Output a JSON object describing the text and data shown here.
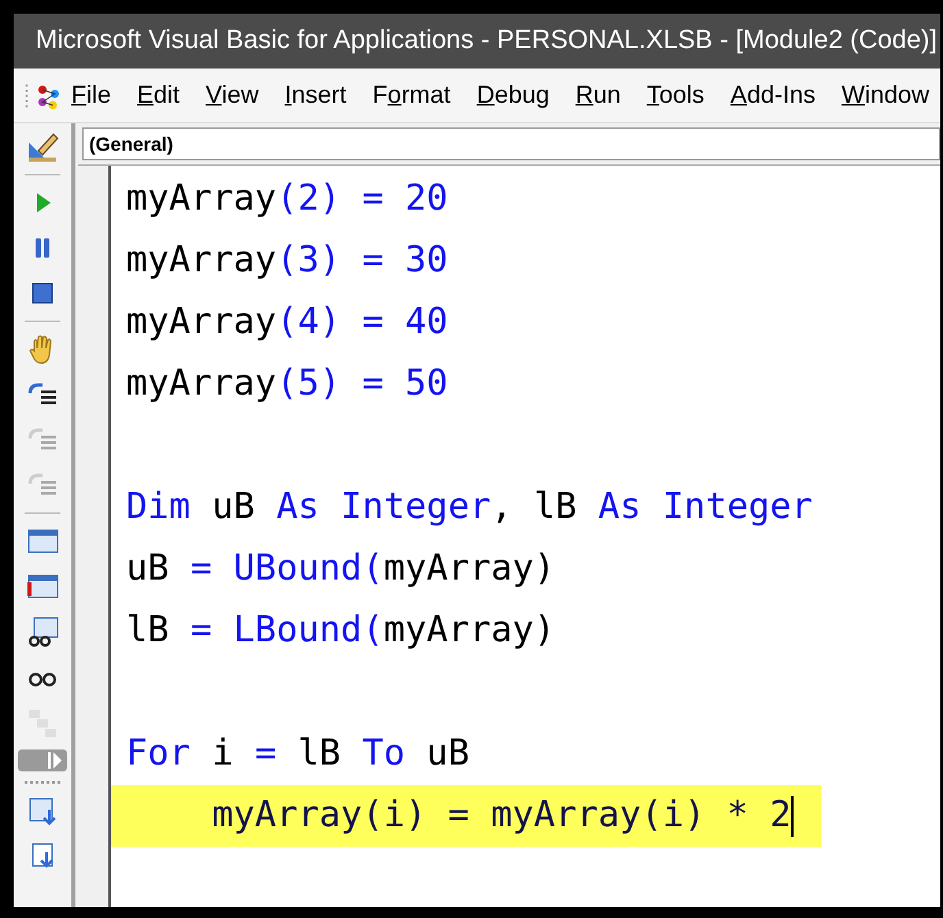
{
  "window": {
    "title": "Microsoft Visual Basic for Applications - PERSONAL.XLSB - [Module2 (Code)]"
  },
  "menu": [
    {
      "mnemonic": "F",
      "after": "ile"
    },
    {
      "mnemonic": "E",
      "after": "dit"
    },
    {
      "mnemonic": "V",
      "after": "iew"
    },
    {
      "mnemonic": "I",
      "after": "nsert"
    },
    {
      "before": "F",
      "mnemonic": "o",
      "after": "rmat"
    },
    {
      "mnemonic": "D",
      "after": "ebug"
    },
    {
      "mnemonic": "R",
      "after": "un"
    },
    {
      "mnemonic": "T",
      "after": "ools"
    },
    {
      "mnemonic": "A",
      "after": "dd-Ins"
    },
    {
      "mnemonic": "W",
      "after": "indow"
    }
  ],
  "toolbar": [
    {
      "kind": "design",
      "disabled": false
    },
    {
      "kind": "separator"
    },
    {
      "kind": "run",
      "disabled": false
    },
    {
      "kind": "pause",
      "disabled": false
    },
    {
      "kind": "stop",
      "disabled": false
    },
    {
      "kind": "separator"
    },
    {
      "kind": "hand",
      "disabled": false
    },
    {
      "kind": "step",
      "disabled": false
    },
    {
      "kind": "step",
      "disabled": true
    },
    {
      "kind": "step",
      "disabled": true
    },
    {
      "kind": "separator"
    },
    {
      "kind": "window",
      "disabled": false
    },
    {
      "kind": "window-alert",
      "disabled": false
    },
    {
      "kind": "watch-window",
      "disabled": false
    },
    {
      "kind": "glasses",
      "disabled": false
    },
    {
      "kind": "stack",
      "disabled": true
    },
    {
      "kind": "overflow"
    },
    {
      "kind": "gripper"
    },
    {
      "kind": "indent",
      "disabled": false
    },
    {
      "kind": "outdent",
      "disabled": false
    }
  ],
  "object_combo": {
    "value": "(General)"
  },
  "code_lines": [
    {
      "highlighted": false,
      "segments": [
        {
          "text": "myArray",
          "kind": "plain"
        },
        {
          "text": "(2) = 20",
          "kind": "keyword"
        }
      ]
    },
    {
      "highlighted": false,
      "segments": [
        {
          "text": "myArray",
          "kind": "plain"
        },
        {
          "text": "(3) = 30",
          "kind": "keyword"
        }
      ]
    },
    {
      "highlighted": false,
      "segments": [
        {
          "text": "myArray",
          "kind": "plain"
        },
        {
          "text": "(4) = 40",
          "kind": "keyword"
        }
      ]
    },
    {
      "highlighted": false,
      "segments": [
        {
          "text": "myArray",
          "kind": "plain"
        },
        {
          "text": "(5) = 50",
          "kind": "keyword"
        }
      ]
    },
    {
      "kind": "blank"
    },
    {
      "highlighted": false,
      "segments": [
        {
          "text": "Dim",
          "kind": "keyword"
        },
        {
          "text": " uB ",
          "kind": "plain"
        },
        {
          "text": "As Integer",
          "kind": "keyword"
        },
        {
          "text": ", lB ",
          "kind": "plain"
        },
        {
          "text": "As Integer",
          "kind": "keyword"
        }
      ]
    },
    {
      "highlighted": false,
      "segments": [
        {
          "text": "uB ",
          "kind": "plain"
        },
        {
          "text": "= UBound(",
          "kind": "keyword"
        },
        {
          "text": "myArray)",
          "kind": "plain"
        }
      ]
    },
    {
      "highlighted": false,
      "segments": [
        {
          "text": "lB ",
          "kind": "plain"
        },
        {
          "text": "= LBound(",
          "kind": "keyword"
        },
        {
          "text": "myArray)",
          "kind": "plain"
        }
      ]
    },
    {
      "kind": "blank"
    },
    {
      "highlighted": false,
      "segments": [
        {
          "text": "For",
          "kind": "keyword"
        },
        {
          "text": " i ",
          "kind": "plain"
        },
        {
          "text": "=",
          "kind": "keyword"
        },
        {
          "text": " lB ",
          "kind": "plain"
        },
        {
          "text": "To",
          "kind": "keyword"
        },
        {
          "text": " uB",
          "kind": "plain"
        }
      ]
    },
    {
      "highlighted": true,
      "segments": [
        {
          "text": "    myArray(i) = myArray(i) * 2",
          "kind": "plain"
        }
      ]
    }
  ]
}
